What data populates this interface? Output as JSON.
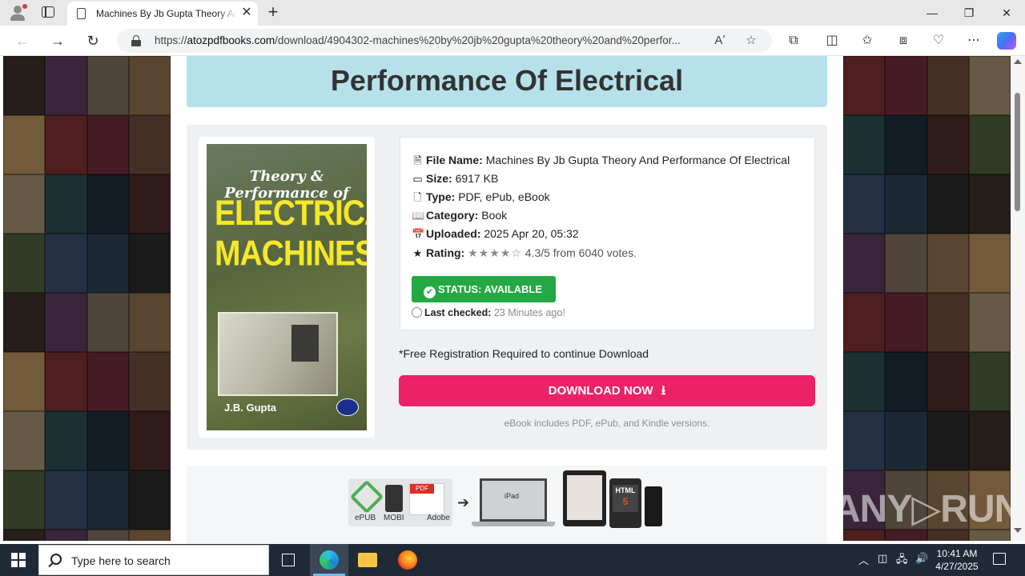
{
  "browser": {
    "tab_title": "Machines By Jb Gupta Theory And Performance Of Electrical",
    "new_tab": "+",
    "close_tab": "✕",
    "window_controls": {
      "minimize": "—",
      "restore": "❐",
      "close": "✕"
    },
    "url_scheme": "https://",
    "url_domain": "atozpdfbooks.com",
    "url_path": "/download/4904302-machines%20by%20jb%20gupta%20theory%20and%20perfor...",
    "icons": [
      "profile-icon",
      "tab-actions-icon",
      "back-icon",
      "forward-icon",
      "refresh-icon",
      "lock-icon",
      "read-aloud-icon",
      "favorite-icon",
      "extensions-icon",
      "split-screen-icon",
      "favorites-icon",
      "collections-icon",
      "performance-icon",
      "more-icon",
      "copilot-icon"
    ]
  },
  "page": {
    "title": "Performance Of Electrical",
    "cover": {
      "top_line": "Theory & Performance of",
      "big_line1": "ELECTRICAL",
      "big_line2": "MACHINES",
      "author": "J.B. Gupta"
    },
    "details": {
      "file_name_label": "File Name:",
      "file_name": "Machines By Jb Gupta Theory And Performance Of Electrical",
      "size_label": "Size:",
      "size": "6917 KB",
      "type_label": "Type:",
      "type": "PDF, ePub, eBook",
      "category_label": "Category:",
      "category": "Book",
      "uploaded_label": "Uploaded:",
      "uploaded": "2025 Apr 20, 05:32",
      "rating_label": "Rating:",
      "rating_stars": "★★★★☆",
      "rating_text": "4.3/5 from 6040 votes.",
      "rating_value": 4.3
    },
    "status": {
      "label": "STATUS: AVAILABLE",
      "color": "#23a843"
    },
    "last_checked": {
      "label": "Last checked:",
      "value": "23 Minutes ago!"
    },
    "registration_note": "*Free Registration Required to continue Download",
    "download_button": {
      "label": "DOWNLOAD NOW",
      "color": "#eb2266"
    },
    "ebook_note": "eBook includes PDF, ePub, and Kindle versions.",
    "formats": {
      "epub": "ePUB",
      "mobi": "MOBI",
      "pdf": "PDF",
      "adobe": "Adobe",
      "html": "HTML",
      "html_ver": "5",
      "ipad": "iPad"
    }
  },
  "watermark": "ANY▷RUN",
  "taskbar": {
    "search_placeholder": "Type here to search",
    "time": "10:41 AM",
    "date": "4/27/2025"
  }
}
